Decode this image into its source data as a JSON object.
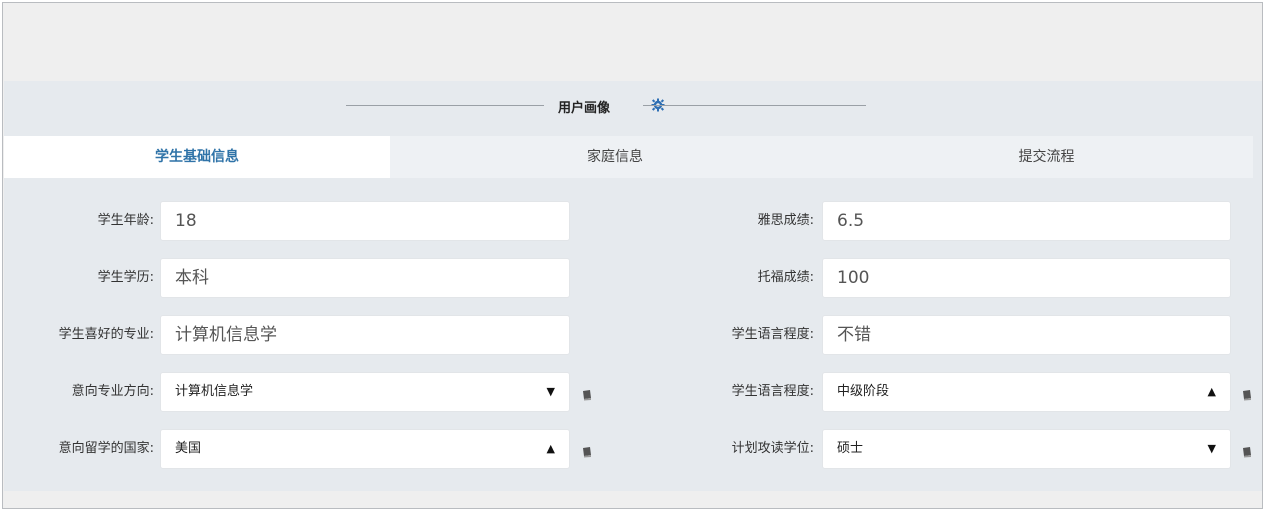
{
  "section": {
    "title": "用户画像",
    "icon": "gear-icon",
    "accent": "#2d6fb4"
  },
  "tabs": [
    {
      "label": "学生基础信息",
      "active": true
    },
    {
      "label": "家庭信息",
      "active": false
    },
    {
      "label": "提交流程",
      "active": false
    }
  ],
  "left_fields": {
    "age": {
      "label": "学生年龄:",
      "value": "18"
    },
    "education": {
      "label": "学生学历:",
      "value": "本科"
    },
    "major": {
      "label": "学生喜好的专业:",
      "value": "计算机信息学"
    },
    "intended_major": {
      "label": "意向专业方向:",
      "value": "计算机信息学",
      "caret": "▼"
    },
    "intended_country": {
      "label": "意向留学的国家:",
      "value": "美国",
      "caret": "▲"
    }
  },
  "right_fields": {
    "ielts": {
      "label": "雅思成绩:",
      "value": "6.5"
    },
    "toefl": {
      "label": "托福成绩:",
      "value": "100"
    },
    "language_level": {
      "label": "学生语言程度:",
      "value": "不错"
    },
    "language_stage": {
      "label": "学生语言程度:",
      "value": "中级阶段",
      "caret": "▲"
    },
    "degree": {
      "label": "计划攻读学位:",
      "value": "硕士",
      "caret": "▼"
    }
  },
  "icons": {
    "book": "book-icon"
  }
}
